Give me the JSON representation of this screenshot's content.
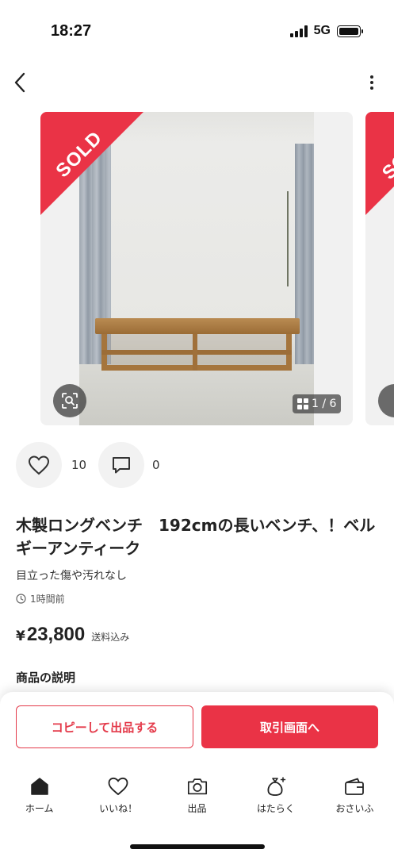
{
  "status_bar": {
    "time": "18:27",
    "network": "5G"
  },
  "carousel": {
    "sold_label": "SOLD",
    "page_indicator": "1 / 6"
  },
  "actions": {
    "like_count": "10",
    "comment_count": "0"
  },
  "product": {
    "title": "木製ロングベンチ　192cmの長いベンチ、！ベルギーアンティーク",
    "condition": "目立った傷や汚れなし",
    "posted": "1時間前",
    "price_currency": "¥",
    "price": "23,800",
    "price_note": "送料込み",
    "description_heading": "商品の説明"
  },
  "buttons": {
    "copy": "コピーして出品する",
    "trade": "取引画面へ"
  },
  "tabs": [
    {
      "label": "ホーム",
      "icon": "home-icon"
    },
    {
      "label": "いいね！",
      "icon": "heart-icon"
    },
    {
      "label": "出品",
      "icon": "camera-icon"
    },
    {
      "label": "はたらく",
      "icon": "money-bag-icon"
    },
    {
      "label": "おさいふ",
      "icon": "wallet-icon"
    }
  ],
  "colors": {
    "accent": "#ea3346",
    "text": "#222222"
  }
}
